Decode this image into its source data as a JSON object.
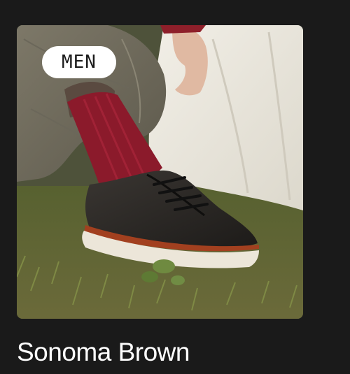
{
  "card": {
    "badge": "MEN",
    "title": "Sonoma Brown"
  },
  "colors": {
    "page_background": "#1a1a1a",
    "badge_background": "#ffffff",
    "title_text": "#ffffff"
  }
}
